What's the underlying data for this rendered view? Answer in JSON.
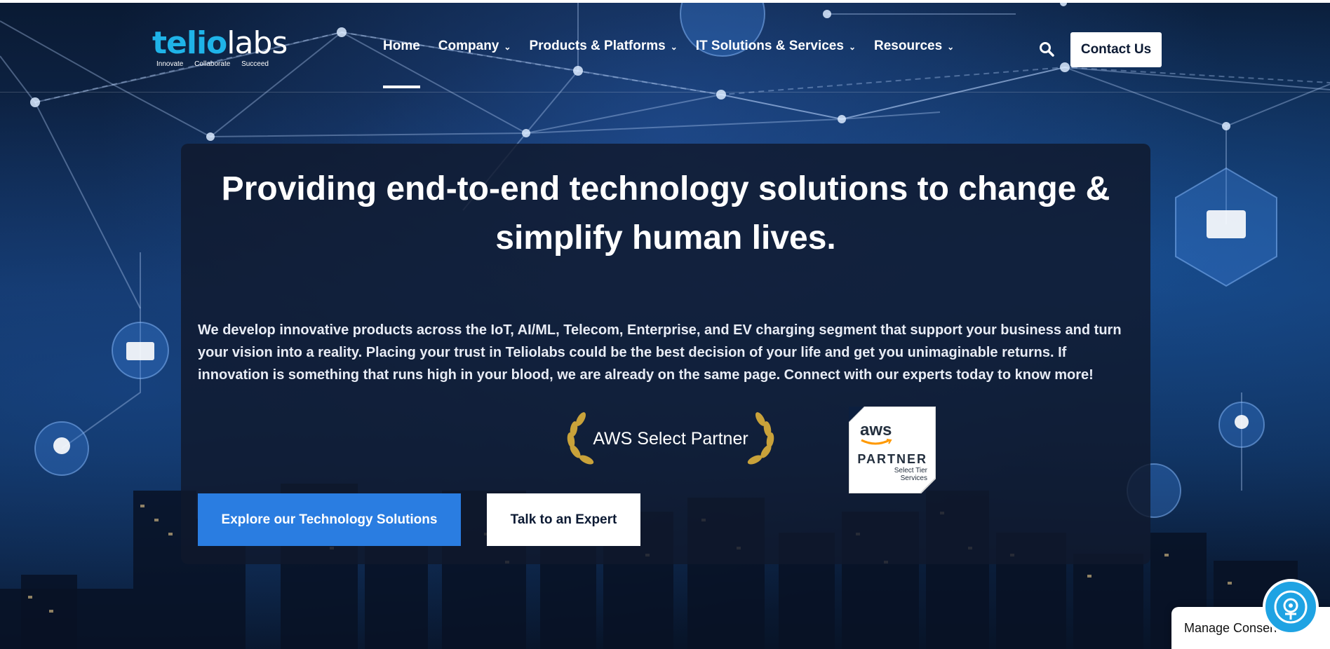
{
  "logo": {
    "brand_part1": "telio",
    "brand_part2": "labs",
    "tag1": "Innovate",
    "tag2": "Collaborate",
    "tag3": "Succeed"
  },
  "nav": {
    "items": [
      {
        "label": "Home",
        "active": true
      },
      {
        "label": "Company"
      },
      {
        "label": "Products & Platforms"
      },
      {
        "label": "IT Solutions & Services"
      },
      {
        "label": "Resources"
      }
    ],
    "search_icon": "search-icon",
    "contact_label": "Contact Us"
  },
  "hero": {
    "title": "Providing end-to-end technology solutions to change & simplify human lives.",
    "description": "We develop innovative products across the IoT, AI/ML, Telecom, Enterprise, and EV charging segment that support your business and turn your vision into a reality. Placing your trust in Teliolabs could be the best decision of your life and get you unimaginable returns. If innovation is something that runs high in your blood, we are already on the same page. Connect with our experts today to know more!",
    "award_text": "AWS Select Partner",
    "aws_badge": {
      "logo": "aws",
      "partner": "PARTNER",
      "tier_line1": "Select Tier",
      "tier_line2": "Services"
    },
    "primary_button": "Explore our Technology Solutions",
    "secondary_button": "Talk to an Expert"
  },
  "consent": {
    "label": "Manage Consent"
  },
  "colors": {
    "accent_blue": "#2a7de1",
    "logo_cyan": "#1fb3e8",
    "card_bg": "#10182c"
  }
}
